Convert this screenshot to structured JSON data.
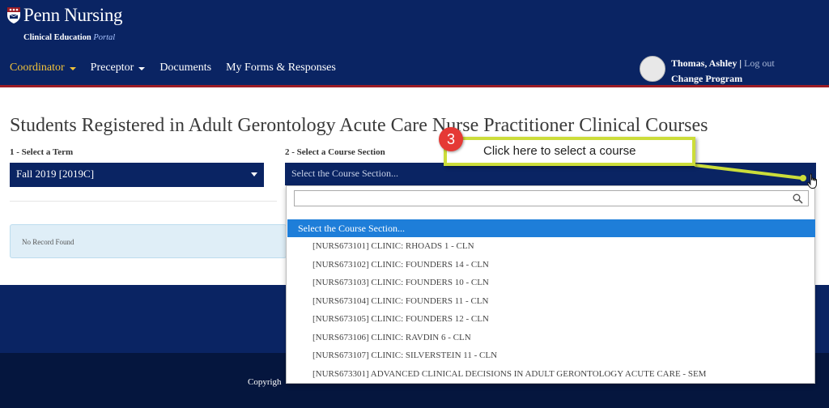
{
  "brand": {
    "name": "Penn Nursing",
    "subtitle": "Clinical Education",
    "portal": "Portal"
  },
  "nav": {
    "items": [
      {
        "label": "Coordinator",
        "dropdown": true,
        "active": true
      },
      {
        "label": "Preceptor",
        "dropdown": true,
        "active": false
      },
      {
        "label": "Documents",
        "dropdown": false,
        "active": false
      },
      {
        "label": "My Forms & Responses",
        "dropdown": false,
        "active": false
      }
    ]
  },
  "user": {
    "name": "Thomas, Ashley",
    "separator": "|",
    "logout": "Log out",
    "change_program": "Change Program"
  },
  "page": {
    "title": "Students Registered in Adult Gerontology Acute Care Nurse Practitioner Clinical Courses",
    "term_label": "1 - Select a Term",
    "term_value": "Fall 2019 [2019C]",
    "section_label": "2 - Select a Course Section",
    "section_value": "Select the Course Section...",
    "no_record": "No Record Found",
    "copyright": "Copyrigh"
  },
  "dropdown": {
    "search_value": "",
    "options": [
      {
        "label": "Select the Course Section...",
        "selected": true
      },
      {
        "label": "[NURS673101] CLINIC: RHOADS 1 - CLN",
        "selected": false
      },
      {
        "label": "[NURS673102] CLINIC: FOUNDERS 14 - CLN",
        "selected": false
      },
      {
        "label": "[NURS673103] CLINIC: FOUNDERS 10 - CLN",
        "selected": false
      },
      {
        "label": "[NURS673104] CLINIC: FOUNDERS 11 - CLN",
        "selected": false
      },
      {
        "label": "[NURS673105] CLINIC: FOUNDERS 12 - CLN",
        "selected": false
      },
      {
        "label": "[NURS673106] CLINIC: RAVDIN 6 - CLN",
        "selected": false
      },
      {
        "label": "[NURS673107] CLINIC: SILVERSTEIN 11 - CLN",
        "selected": false
      },
      {
        "label": "[NURS673301] ADVANCED CLINICAL DECISIONS IN ADULT GERONTOLOGY ACUTE CARE - SEM",
        "selected": false
      }
    ]
  },
  "annotation": {
    "step": "3",
    "text": "Click here to select a course"
  },
  "colors": {
    "navy": "#0a2463",
    "accent_gold": "#f2c33a",
    "crimson": "#9b1c25",
    "highlight_blue": "#1e7ed9",
    "callout_border": "#ccdd3a",
    "badge_red": "#e53935"
  },
  "icons": {
    "logo": "penn-shield-icon",
    "search": "search-icon",
    "cursor": "hand-pointer-icon"
  }
}
